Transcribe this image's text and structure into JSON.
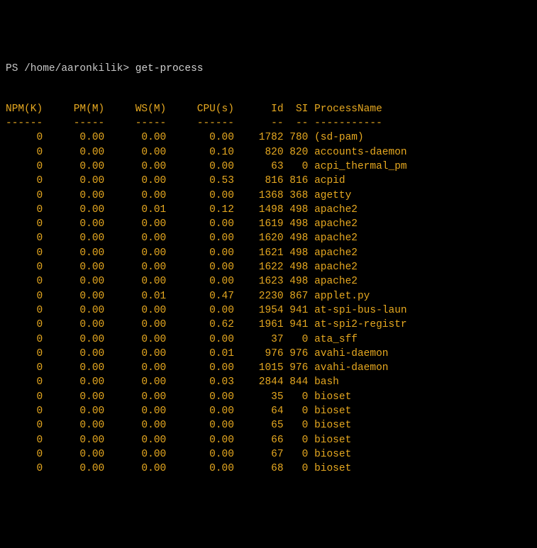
{
  "prompt": {
    "ps": "PS",
    "path": "/home/aaronkilik>",
    "command": "get-process"
  },
  "columns": [
    "NPM(K)",
    "PM(M)",
    "WS(M)",
    "CPU(s)",
    "Id",
    "SI",
    "ProcessName"
  ],
  "separators": [
    "------",
    "-----",
    "-----",
    "------",
    "--",
    "--",
    "-----------"
  ],
  "rows": [
    {
      "npm": "0",
      "pm": "0.00",
      "ws": "0.00",
      "cpu": "0.00",
      "id": "1782",
      "si": "780",
      "name": "(sd-pam)"
    },
    {
      "npm": "0",
      "pm": "0.00",
      "ws": "0.00",
      "cpu": "0.10",
      "id": "820",
      "si": "820",
      "name": "accounts-daemon"
    },
    {
      "npm": "0",
      "pm": "0.00",
      "ws": "0.00",
      "cpu": "0.00",
      "id": "63",
      "si": "0",
      "name": "acpi_thermal_pm"
    },
    {
      "npm": "0",
      "pm": "0.00",
      "ws": "0.00",
      "cpu": "0.53",
      "id": "816",
      "si": "816",
      "name": "acpid"
    },
    {
      "npm": "0",
      "pm": "0.00",
      "ws": "0.00",
      "cpu": "0.00",
      "id": "1368",
      "si": "368",
      "name": "agetty"
    },
    {
      "npm": "0",
      "pm": "0.00",
      "ws": "0.01",
      "cpu": "0.12",
      "id": "1498",
      "si": "498",
      "name": "apache2"
    },
    {
      "npm": "0",
      "pm": "0.00",
      "ws": "0.00",
      "cpu": "0.00",
      "id": "1619",
      "si": "498",
      "name": "apache2"
    },
    {
      "npm": "0",
      "pm": "0.00",
      "ws": "0.00",
      "cpu": "0.00",
      "id": "1620",
      "si": "498",
      "name": "apache2"
    },
    {
      "npm": "0",
      "pm": "0.00",
      "ws": "0.00",
      "cpu": "0.00",
      "id": "1621",
      "si": "498",
      "name": "apache2"
    },
    {
      "npm": "0",
      "pm": "0.00",
      "ws": "0.00",
      "cpu": "0.00",
      "id": "1622",
      "si": "498",
      "name": "apache2"
    },
    {
      "npm": "0",
      "pm": "0.00",
      "ws": "0.00",
      "cpu": "0.00",
      "id": "1623",
      "si": "498",
      "name": "apache2"
    },
    {
      "npm": "0",
      "pm": "0.00",
      "ws": "0.01",
      "cpu": "0.47",
      "id": "2230",
      "si": "867",
      "name": "applet.py"
    },
    {
      "npm": "0",
      "pm": "0.00",
      "ws": "0.00",
      "cpu": "0.00",
      "id": "1954",
      "si": "941",
      "name": "at-spi-bus-laun"
    },
    {
      "npm": "0",
      "pm": "0.00",
      "ws": "0.00",
      "cpu": "0.62",
      "id": "1961",
      "si": "941",
      "name": "at-spi2-registr"
    },
    {
      "npm": "0",
      "pm": "0.00",
      "ws": "0.00",
      "cpu": "0.00",
      "id": "37",
      "si": "0",
      "name": "ata_sff"
    },
    {
      "npm": "0",
      "pm": "0.00",
      "ws": "0.00",
      "cpu": "0.01",
      "id": "976",
      "si": "976",
      "name": "avahi-daemon"
    },
    {
      "npm": "0",
      "pm": "0.00",
      "ws": "0.00",
      "cpu": "0.00",
      "id": "1015",
      "si": "976",
      "name": "avahi-daemon"
    },
    {
      "npm": "0",
      "pm": "0.00",
      "ws": "0.00",
      "cpu": "0.03",
      "id": "2844",
      "si": "844",
      "name": "bash"
    },
    {
      "npm": "0",
      "pm": "0.00",
      "ws": "0.00",
      "cpu": "0.00",
      "id": "35",
      "si": "0",
      "name": "bioset"
    },
    {
      "npm": "0",
      "pm": "0.00",
      "ws": "0.00",
      "cpu": "0.00",
      "id": "64",
      "si": "0",
      "name": "bioset"
    },
    {
      "npm": "0",
      "pm": "0.00",
      "ws": "0.00",
      "cpu": "0.00",
      "id": "65",
      "si": "0",
      "name": "bioset"
    },
    {
      "npm": "0",
      "pm": "0.00",
      "ws": "0.00",
      "cpu": "0.00",
      "id": "66",
      "si": "0",
      "name": "bioset"
    },
    {
      "npm": "0",
      "pm": "0.00",
      "ws": "0.00",
      "cpu": "0.00",
      "id": "67",
      "si": "0",
      "name": "bioset"
    },
    {
      "npm": "0",
      "pm": "0.00",
      "ws": "0.00",
      "cpu": "0.00",
      "id": "68",
      "si": "0",
      "name": "bioset"
    }
  ]
}
